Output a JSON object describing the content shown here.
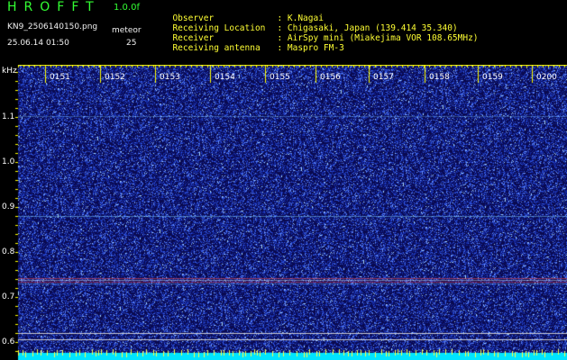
{
  "header": {
    "app_title": "HROFFT",
    "version": "1.0.0f",
    "filename": "KN9_2506140150.png",
    "meteor_label": "meteor",
    "datetime": "25.06.14 01:50",
    "meteor_count": "25"
  },
  "info": [
    {
      "key": "Observer",
      "value": ": K.Nagai"
    },
    {
      "key": "Receiving Location",
      "value": ": Chigasaki, Japan (139.414 35.340)"
    },
    {
      "key": "Receiver",
      "value": ": AirSpy mini (Miakejima VOR 108.65MHz)"
    },
    {
      "key": "Receiving antenna",
      "value": ": Maspro FM-3"
    }
  ],
  "spectrogram": {
    "unit": "kHz",
    "y_ticks": [
      "1.1",
      "1.0",
      "0.9",
      "0.8",
      "0.7",
      "0.6"
    ],
    "x_ticks": [
      "0151",
      "0152",
      "0153",
      "0154",
      "0155",
      "0156",
      "0157",
      "0158",
      "0159",
      "0200"
    ],
    "colors": {
      "background": "#0a0a55",
      "noise_low": "#1a2aa0",
      "noise_high": "#4a6aff",
      "hot": "#ff4040",
      "cyan": "#00e5ff",
      "tick": "#ffff00"
    }
  }
}
